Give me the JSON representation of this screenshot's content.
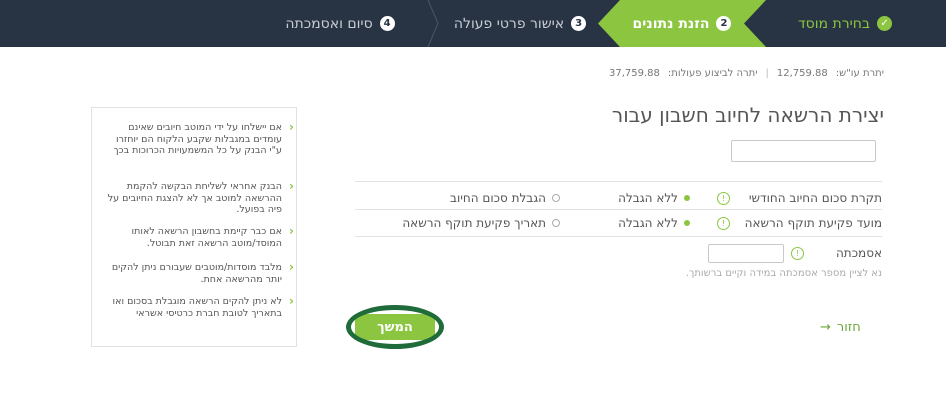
{
  "steps": [
    {
      "num": "✓",
      "label": "בחירת מוסד",
      "state": "done"
    },
    {
      "num": "2",
      "label": "הזנת נתונים",
      "state": "active"
    },
    {
      "num": "3",
      "label": "אישור פרטי פעולה",
      "state": "pending"
    },
    {
      "num": "4",
      "label": "סיום ואסמכתה",
      "state": "pending"
    }
  ],
  "balances": {
    "balance_label": "יתרת עו\"ש:",
    "balance_value": "12,759.88",
    "available_label": "יתרה לביצוע פעולות:",
    "available_value": "37,759.88"
  },
  "form": {
    "title": "יצירת הרשאה לחיוב חשבון עבור",
    "account_value": "",
    "rows": [
      {
        "label": "תקרת סכום החיוב החודשי",
        "opt1": "ללא הגבלה",
        "opt2": "הגבלת סכום החיוב"
      },
      {
        "label": "מועד פקיעת תוקף הרשאה",
        "opt1": "ללא הגבלה",
        "opt2": "תאריך פקיעת תוקף הרשאה"
      },
      {
        "label": "אסמכתה"
      }
    ],
    "reference_value": "",
    "hint": "נא לציין מספר אסמכתה במידה וקיים ברשותך."
  },
  "buttons": {
    "continue": "המשך",
    "back": "חזור",
    "back_arrow": "→"
  },
  "tips": [
    "אם יישלחו על ידי המוטב חיובים שאינם עומדים במגבלות שקבע הלקוח הם יוחזרו ע\"י הבנק על כל המשמעויות הכרוכות בכך",
    "הבנק אחראי לשליחת הבקשה להקמת ההרשאה למוטב אך לא להצגת החיובים על פיה בפועל.",
    "אם כבר קיימת בחשבון הרשאה לאותו המוסד/מוטב הרשאה זאת תבוטל.",
    "מלבד מוסדות/מוטבים שעבורם ניתן להקים יותר מהרשאה אחת.",
    "לא ניתן להקים הרשאה מוגבלת בסכום ואו בתאריך לטובת חברת כרטיסי אשראי"
  ],
  "colors": {
    "accent": "#8cc641",
    "header_bg": "#283444",
    "highlight_ring": "#1f6b3a"
  }
}
